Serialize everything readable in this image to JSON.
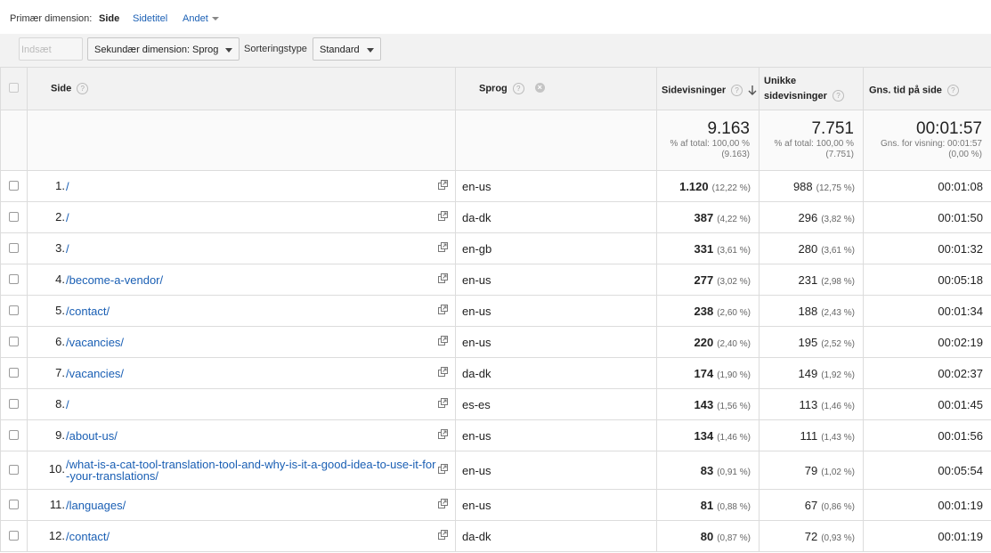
{
  "dimension_bar": {
    "label": "Primær dimension:",
    "active": "Side",
    "options": [
      "Sidetitel",
      "Andet"
    ]
  },
  "toolbar": {
    "insert_rows": "Indsæt rækker",
    "secondary_dimension": "Sekundær dimension: Sprog",
    "sort_label": "Sorteringstype",
    "sort_value": "Standard"
  },
  "columns": {
    "side": "Side",
    "sprog": "Sprog",
    "sidevisninger": "Sidevisninger",
    "unikke_line1": "Unikke",
    "unikke_line2": "sidevisninger",
    "tid": "Gns. tid på side"
  },
  "summary": {
    "sidevisninger": "9.163",
    "sidevisninger_sub1": "% af total: 100,00 %",
    "sidevisninger_sub2": "(9.163)",
    "unikke": "7.751",
    "unikke_sub1": "% af total: 100,00 %",
    "unikke_sub2": "(7.751)",
    "tid": "00:01:57",
    "tid_sub1": "Gns. for visning: 00:01:57",
    "tid_sub2": "(0,00 %)"
  },
  "rows": [
    {
      "n": "1.",
      "page": "/",
      "lang": "en-us",
      "views": "1.120",
      "views_pct": "(12,22 %)",
      "unique": "988",
      "unique_pct": "(12,75 %)",
      "time": "00:01:08"
    },
    {
      "n": "2.",
      "page": "/",
      "lang": "da-dk",
      "views": "387",
      "views_pct": "(4,22 %)",
      "unique": "296",
      "unique_pct": "(3,82 %)",
      "time": "00:01:50"
    },
    {
      "n": "3.",
      "page": "/",
      "lang": "en-gb",
      "views": "331",
      "views_pct": "(3,61 %)",
      "unique": "280",
      "unique_pct": "(3,61 %)",
      "time": "00:01:32"
    },
    {
      "n": "4.",
      "page": "/become-a-vendor/",
      "lang": "en-us",
      "views": "277",
      "views_pct": "(3,02 %)",
      "unique": "231",
      "unique_pct": "(2,98 %)",
      "time": "00:05:18"
    },
    {
      "n": "5.",
      "page": "/contact/",
      "lang": "en-us",
      "views": "238",
      "views_pct": "(2,60 %)",
      "unique": "188",
      "unique_pct": "(2,43 %)",
      "time": "00:01:34"
    },
    {
      "n": "6.",
      "page": "/vacancies/",
      "lang": "en-us",
      "views": "220",
      "views_pct": "(2,40 %)",
      "unique": "195",
      "unique_pct": "(2,52 %)",
      "time": "00:02:19"
    },
    {
      "n": "7.",
      "page": "/vacancies/",
      "lang": "da-dk",
      "views": "174",
      "views_pct": "(1,90 %)",
      "unique": "149",
      "unique_pct": "(1,92 %)",
      "time": "00:02:37"
    },
    {
      "n": "8.",
      "page": "/",
      "lang": "es-es",
      "views": "143",
      "views_pct": "(1,56 %)",
      "unique": "113",
      "unique_pct": "(1,46 %)",
      "time": "00:01:45"
    },
    {
      "n": "9.",
      "page": "/about-us/",
      "lang": "en-us",
      "views": "134",
      "views_pct": "(1,46 %)",
      "unique": "111",
      "unique_pct": "(1,43 %)",
      "time": "00:01:56"
    },
    {
      "n": "10.",
      "page": "/what-is-a-cat-tool-translation-tool-and-why-is-it-a-good-idea-to-use-it-for-your-translations/",
      "page_line1": "/what-is-a-cat-tool-translation-tool-and-why-is-it-a-good-idea-to-use-it-for",
      "page_line2": "-your-translations/",
      "lang": "en-us",
      "views": "83",
      "views_pct": "(0,91 %)",
      "unique": "79",
      "unique_pct": "(1,02 %)",
      "time": "00:05:54"
    },
    {
      "n": "11.",
      "page": "/languages/",
      "lang": "en-us",
      "views": "81",
      "views_pct": "(0,88 %)",
      "unique": "67",
      "unique_pct": "(0,86 %)",
      "time": "00:01:19"
    },
    {
      "n": "12.",
      "page": "/contact/",
      "lang": "da-dk",
      "views": "80",
      "views_pct": "(0,87 %)",
      "unique": "72",
      "unique_pct": "(0,93 %)",
      "time": "00:01:19"
    }
  ],
  "colors": {
    "link": "#1a5fb4",
    "header_bg": "#f2f2f2",
    "border": "#dcdcdc"
  }
}
